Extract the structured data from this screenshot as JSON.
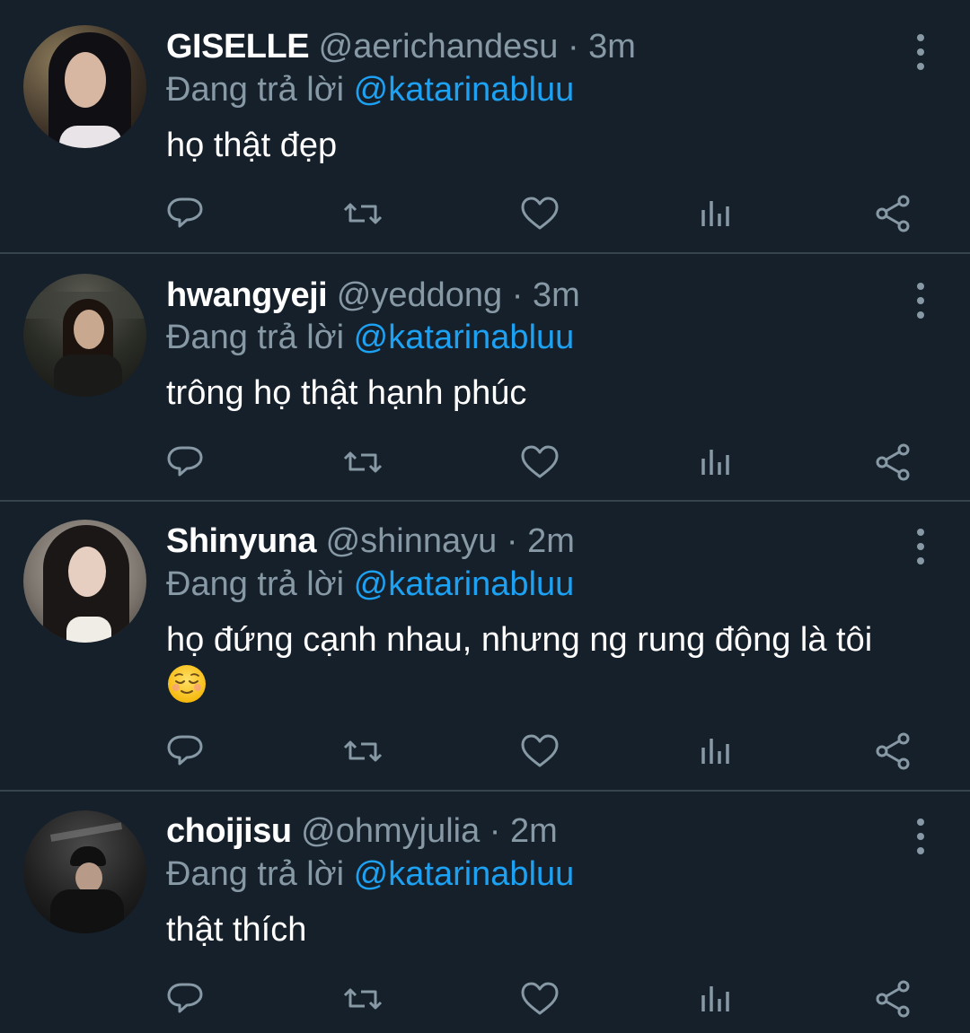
{
  "colors": {
    "background": "#15202b",
    "divider": "#38444d",
    "secondary_text": "#8899a6",
    "mention": "#1da1f2",
    "primary_text": "#ffffff"
  },
  "tweets": [
    {
      "name": "GISELLE",
      "handle": "@aerichandesu",
      "separator": "·",
      "time": "3m",
      "replying_prefix": "Đang trả lời",
      "replying_to": "@katarinabluu",
      "text": "họ thật đẹp",
      "emoji": ""
    },
    {
      "name": "hwangyeji",
      "handle": "@yeddong",
      "separator": "·",
      "time": "3m",
      "replying_prefix": "Đang trả lời",
      "replying_to": "@katarinabluu",
      "text": "trông họ thật hạnh phúc",
      "emoji": ""
    },
    {
      "name": "Shinyuna",
      "handle": "@shinnayu",
      "separator": "·",
      "time": "2m",
      "replying_prefix": "Đang trả lời",
      "replying_to": "@katarinabluu",
      "text": "họ đứng cạnh nhau, nhưng ng rung động là tôi",
      "emoji": "relieved-face"
    },
    {
      "name": "choijisu",
      "handle": "@ohmyjulia",
      "separator": "·",
      "time": "2m",
      "replying_prefix": "Đang trả lời",
      "replying_to": "@katarinabluu",
      "text": "thật thích",
      "emoji": ""
    }
  ],
  "action_icons": [
    "reply-icon",
    "retweet-icon",
    "like-icon",
    "analytics-icon",
    "share-icon"
  ],
  "more_icon": "more-vertical-icon"
}
